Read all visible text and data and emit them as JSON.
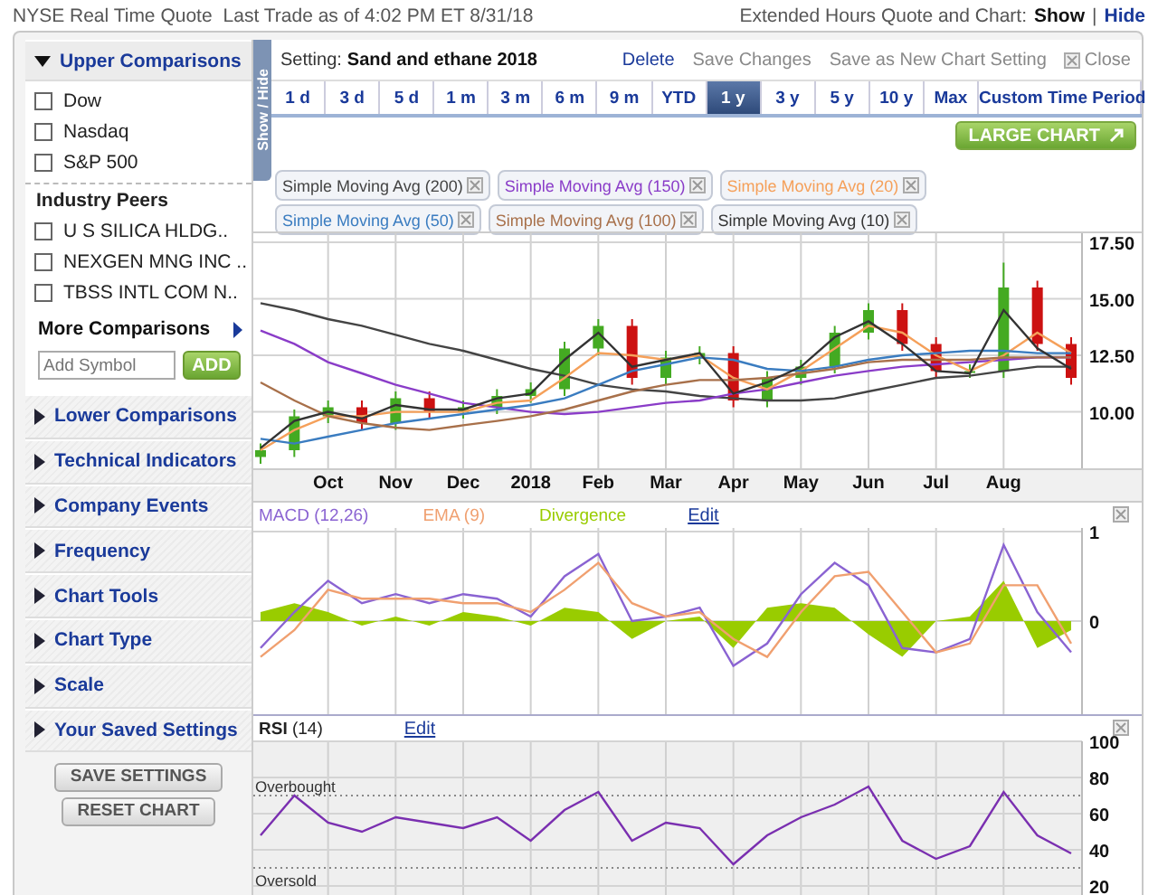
{
  "header": {
    "quote": "NYSE Real Time Quote",
    "last_trade": "Last Trade as of 4:02 PM ET 8/31/18",
    "extended_label": "Extended Hours Quote and Chart:",
    "show_link": "Show",
    "separator": "|",
    "hide_link": "Hide"
  },
  "sidebar": {
    "upper": {
      "label": "Upper Comparisons",
      "expanded": true,
      "indices": [
        {
          "label": "Dow",
          "checked": false
        },
        {
          "label": "Nasdaq",
          "checked": false
        },
        {
          "label": "S&P 500",
          "checked": false
        }
      ],
      "peers_title": "Industry Peers",
      "peers": [
        {
          "label": "U S SILICA HLDG..",
          "checked": false
        },
        {
          "label": "NEXGEN MNG INC ..",
          "checked": false
        },
        {
          "label": "TBSS INTL COM N..",
          "checked": false
        }
      ],
      "more_label": "More Comparisons",
      "symbol_placeholder": "Add Symbol",
      "add_button": "ADD"
    },
    "sections": [
      {
        "label": "Lower Comparisons",
        "expanded": false
      },
      {
        "label": "Technical Indicators",
        "expanded": false
      },
      {
        "label": "Company Events",
        "expanded": false
      },
      {
        "label": "Frequency",
        "expanded": false
      },
      {
        "label": "Chart Tools",
        "expanded": false
      },
      {
        "label": "Chart Type",
        "expanded": false
      },
      {
        "label": "Scale",
        "expanded": false
      },
      {
        "label": "Your Saved Settings",
        "expanded": false
      }
    ],
    "buttons": [
      "SAVE SETTINGS",
      "RESET CHART"
    ]
  },
  "toggle_label": "Show / Hide",
  "setting": {
    "label": "Setting:",
    "value": "Sand and ethane 2018",
    "actions": [
      {
        "label": "Delete",
        "kind": "link",
        "disabled": false
      },
      {
        "label": "Save Changes",
        "kind": "link",
        "disabled": true
      },
      {
        "label": "Save as New Chart Setting",
        "kind": "link",
        "disabled": true
      },
      {
        "label": "Close",
        "kind": "close",
        "disabled": true
      }
    ]
  },
  "time_tabs": [
    {
      "label": "1 d",
      "selected": false
    },
    {
      "label": "3 d",
      "selected": false
    },
    {
      "label": "5 d",
      "selected": false
    },
    {
      "label": "1 m",
      "selected": false
    },
    {
      "label": "3 m",
      "selected": false
    },
    {
      "label": "6 m",
      "selected": false
    },
    {
      "label": "9 m",
      "selected": false
    },
    {
      "label": "YTD",
      "selected": false
    },
    {
      "label": "1 y",
      "selected": true
    },
    {
      "label": "3 y",
      "selected": false
    },
    {
      "label": "5 y",
      "selected": false
    },
    {
      "label": "10 y",
      "selected": false
    },
    {
      "label": "Max",
      "selected": false
    },
    {
      "label": "Custom Time Period",
      "selected": false
    }
  ],
  "large_chart_button": "LARGE CHART",
  "price_chart": {
    "chart_data": {
      "type": "candlestick",
      "grid": true,
      "categories": [
        null,
        null,
        "Oct",
        null,
        "Nov",
        null,
        "Dec",
        null,
        "2018",
        null,
        "Feb",
        null,
        "Mar",
        null,
        "Apr",
        null,
        "May",
        null,
        "Jun",
        null,
        "Jul",
        null,
        "Aug",
        null,
        null
      ],
      "ylim": [
        7.5,
        17.9
      ],
      "yticks": [
        {
          "value": 10,
          "label": "10.00"
        },
        {
          "value": 12.5,
          "label": "12.50"
        },
        {
          "value": 15,
          "label": "15.00"
        },
        {
          "value": 17.5,
          "label": "17.50"
        }
      ],
      "ohlc": [
        [
          8.0,
          8.6,
          7.7,
          8.3
        ],
        [
          8.3,
          10.1,
          8.0,
          9.8
        ],
        [
          9.8,
          10.5,
          9.5,
          10.2
        ],
        [
          10.2,
          10.5,
          9.2,
          9.5
        ],
        [
          9.5,
          10.9,
          9.2,
          10.6
        ],
        [
          10.6,
          10.9,
          9.7,
          10.0
        ],
        [
          10.0,
          10.5,
          9.7,
          10.2
        ],
        [
          10.2,
          11.0,
          9.9,
          10.7
        ],
        [
          10.7,
          11.3,
          10.4,
          11.0
        ],
        [
          11.0,
          13.1,
          10.7,
          12.8
        ],
        [
          12.8,
          14.1,
          12.5,
          13.8
        ],
        [
          13.8,
          14.1,
          11.2,
          11.5
        ],
        [
          11.5,
          12.7,
          11.2,
          12.4
        ],
        [
          12.4,
          12.9,
          12.1,
          12.6
        ],
        [
          12.6,
          12.9,
          10.2,
          10.5
        ],
        [
          10.5,
          11.8,
          10.2,
          11.5
        ],
        [
          11.5,
          12.3,
          11.2,
          12.0
        ],
        [
          12.0,
          13.8,
          11.7,
          13.5
        ],
        [
          13.5,
          14.8,
          13.2,
          14.5
        ],
        [
          14.5,
          14.8,
          12.7,
          13.0
        ],
        [
          13.0,
          13.3,
          11.5,
          11.8
        ],
        [
          11.8,
          12.1,
          11.5,
          11.8
        ],
        [
          11.8,
          16.6,
          11.5,
          15.5
        ],
        [
          15.5,
          15.8,
          12.7,
          13.0
        ],
        [
          13.0,
          13.3,
          11.2,
          11.5
        ]
      ],
      "series": [
        {
          "name": "Simple Moving Avg (200)",
          "type": "line",
          "color": "#444444",
          "values": [
            14.8,
            14.5,
            14.1,
            13.8,
            13.4,
            13.0,
            12.7,
            12.3,
            11.9,
            11.6,
            11.2,
            11.0,
            10.9,
            10.7,
            10.6,
            10.5,
            10.5,
            10.6,
            10.9,
            11.2,
            11.5,
            11.6,
            11.8,
            12.0,
            12.0
          ]
        },
        {
          "name": "Simple Moving Avg (150)",
          "type": "line",
          "color": "#8a3cc8",
          "values": [
            13.6,
            13.0,
            12.2,
            11.7,
            11.2,
            10.8,
            10.4,
            10.2,
            10.0,
            9.9,
            10.0,
            10.2,
            10.4,
            10.5,
            10.8,
            11.0,
            11.3,
            11.6,
            11.8,
            12.0,
            12.1,
            12.2,
            12.3,
            12.4,
            12.4
          ]
        },
        {
          "name": "Simple Moving Avg (20)",
          "type": "line",
          "color": "#f5a05a",
          "values": [
            8.3,
            9.2,
            9.8,
            9.8,
            10.0,
            10.0,
            10.0,
            10.4,
            10.5,
            11.5,
            12.6,
            12.5,
            12.3,
            12.5,
            11.5,
            11.0,
            11.8,
            12.8,
            13.8,
            13.5,
            12.5,
            11.8,
            12.5,
            13.5,
            12.6
          ]
        },
        {
          "name": "Simple Moving Avg (50)",
          "type": "line",
          "color": "#3a7cc0",
          "values": [
            8.8,
            8.6,
            8.9,
            9.2,
            9.5,
            9.7,
            9.9,
            10.1,
            10.3,
            10.6,
            11.2,
            11.8,
            12.1,
            12.4,
            12.3,
            11.9,
            11.8,
            12.0,
            12.3,
            12.5,
            12.6,
            12.7,
            12.7,
            12.6,
            12.6
          ]
        },
        {
          "name": "Simple Moving Avg (100)",
          "type": "line",
          "color": "#a8704a",
          "values": [
            11.3,
            10.5,
            9.8,
            9.5,
            9.3,
            9.2,
            9.4,
            9.6,
            9.8,
            10.1,
            10.5,
            10.9,
            11.2,
            11.4,
            11.4,
            11.5,
            11.7,
            11.9,
            12.2,
            12.3,
            12.3,
            12.3,
            12.4,
            12.4,
            12.4
          ]
        },
        {
          "name": "Simple Moving Avg (10)",
          "type": "line",
          "color": "#333333",
          "values": [
            8.4,
            9.6,
            10.0,
            9.7,
            10.3,
            10.1,
            10.1,
            10.6,
            10.8,
            12.3,
            13.5,
            12.0,
            12.3,
            12.6,
            10.8,
            11.3,
            12.0,
            13.3,
            14.0,
            13.0,
            11.8,
            11.7,
            14.5,
            12.8,
            11.9
          ]
        }
      ]
    }
  },
  "macd_pane": {
    "edit_link": "Edit",
    "chart_data": {
      "type": "line",
      "grid": true,
      "ylim": [
        -1.04,
        1.04
      ],
      "yticks": [
        0,
        1
      ],
      "series": [
        {
          "name": "MACD (12,26)",
          "color": "#8a63d2",
          "values": [
            -0.3,
            0.1,
            0.45,
            0.2,
            0.3,
            0.2,
            0.3,
            0.25,
            0.05,
            0.5,
            0.75,
            0.0,
            0.05,
            0.15,
            -0.5,
            -0.25,
            0.3,
            0.65,
            0.4,
            -0.3,
            -0.35,
            -0.2,
            0.85,
            0.1,
            -0.35
          ]
        },
        {
          "name": "EMA (9)",
          "color": "#f0a070",
          "values": [
            -0.4,
            -0.1,
            0.35,
            0.25,
            0.25,
            0.25,
            0.2,
            0.2,
            0.1,
            0.35,
            0.65,
            0.2,
            0.05,
            0.1,
            -0.2,
            -0.4,
            0.1,
            0.5,
            0.55,
            0.1,
            -0.35,
            -0.25,
            0.4,
            0.4,
            -0.25
          ]
        },
        {
          "name": "Divergence",
          "type": "area",
          "color": "#99cc00",
          "values": [
            0.1,
            0.2,
            0.1,
            -0.05,
            0.05,
            -0.05,
            0.1,
            0.05,
            -0.05,
            0.15,
            0.1,
            -0.2,
            0,
            0.05,
            -0.3,
            0.15,
            0.2,
            0.15,
            -0.15,
            -0.4,
            0,
            0.05,
            0.45,
            -0.3,
            -0.1
          ]
        }
      ]
    }
  },
  "rsi_pane": {
    "edit_link": "Edit",
    "chart_data": {
      "type": "line",
      "grid": true,
      "ylim": [
        12,
        100
      ],
      "yticks": [
        20,
        40,
        60,
        80,
        100
      ],
      "ref_lines": [
        {
          "axis": "y",
          "value": 70,
          "label": "Overbought"
        },
        {
          "axis": "y",
          "value": 30,
          "label": "Oversold"
        }
      ],
      "series": [
        {
          "name": "**RSI** (14)",
          "color": "#7a2fb0",
          "values": [
            48,
            70,
            55,
            50,
            58,
            55,
            52,
            58,
            45,
            62,
            72,
            45,
            55,
            52,
            32,
            48,
            58,
            65,
            75,
            45,
            35,
            42,
            72,
            48,
            38
          ]
        }
      ]
    }
  }
}
